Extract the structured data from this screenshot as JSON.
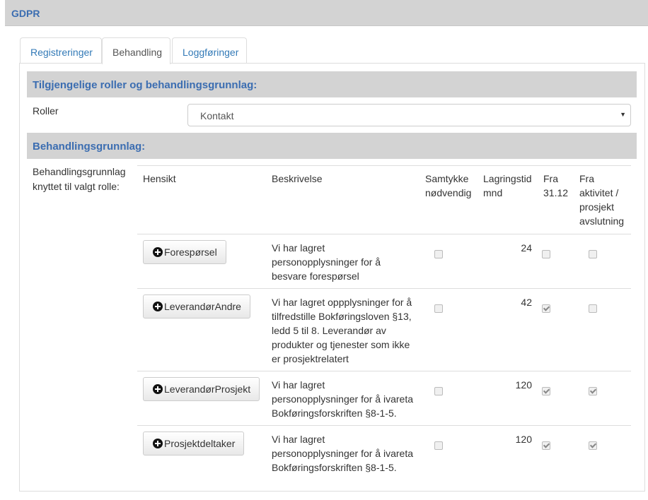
{
  "app": {
    "title": "GDPR"
  },
  "tabs": [
    {
      "label": "Registreringer",
      "active": false
    },
    {
      "label": "Behandling",
      "active": true
    },
    {
      "label": "Loggføringer",
      "active": false
    }
  ],
  "roles_section": {
    "title": "Tilgjengelige roller og behandlingsgrunnlag:",
    "roles_label": "Roller",
    "selected_role": "Kontakt"
  },
  "basis_section": {
    "title": "Behandlingsgrunnlag:",
    "side_label_line1": "Behandlingsgrunnlag",
    "side_label_line2": "knyttet til valgt rolle:"
  },
  "table": {
    "headers": {
      "purpose": "Hensikt",
      "description": "Beskrivelse",
      "consent_line1": "Samtykke",
      "consent_line2": "nødvendig",
      "retention_line1": "Lagringstid",
      "retention_line2": "mnd",
      "from_date_line1": "Fra",
      "from_date_line2": "31.12",
      "from_activity_line1": "Fra",
      "from_activity_line2": "aktivitet /",
      "from_activity_line3": "prosjekt",
      "from_activity_line4": "avslutning"
    },
    "rows": [
      {
        "purpose": "Forespørsel",
        "description_lines": [
          "Vi har lagret",
          "personopplysninger for å",
          "besvare forespørsel"
        ],
        "consent_required": false,
        "retention_months": "24",
        "from_date": false,
        "from_activity": false
      },
      {
        "purpose": "LeverandørAndre",
        "description_lines": [
          "Vi har lagret oppplysninger for å",
          "tilfredstille Bokføringsloven §13,",
          "ledd 5 til 8. Leverandør av",
          "produkter og tjenester som ikke",
          "er prosjektrelatert"
        ],
        "consent_required": false,
        "retention_months": "42",
        "from_date": true,
        "from_activity": false
      },
      {
        "purpose": "LeverandørProsjekt",
        "description_lines": [
          "Vi har lagret",
          "personopplysninger for å ivareta",
          "Bokføringsforskriften §8-1-5."
        ],
        "consent_required": false,
        "retention_months": "120",
        "from_date": true,
        "from_activity": true
      },
      {
        "purpose": "Prosjektdeltaker",
        "description_lines": [
          "Vi har lagret",
          "personopplysninger for å ivareta",
          "Bokføringsforskriften §8-1-5."
        ],
        "consent_required": false,
        "retention_months": "120",
        "from_date": true,
        "from_activity": true
      }
    ]
  }
}
